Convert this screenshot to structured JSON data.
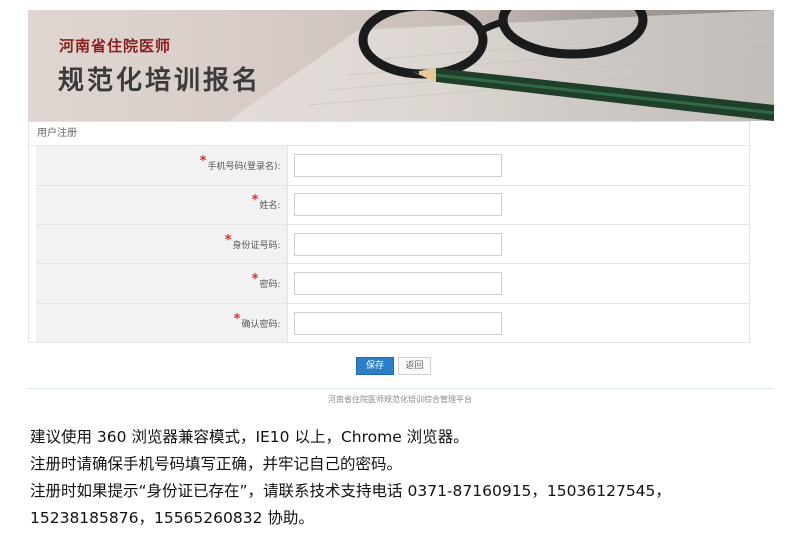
{
  "banner": {
    "subtitle": "河南省住院医师",
    "title": "规范化培训报名"
  },
  "form": {
    "section_title": "用户注册",
    "required_mark": "*",
    "fields": [
      {
        "label": "手机号码(登录名):",
        "value": "",
        "placeholder": ""
      },
      {
        "label": "姓名:",
        "value": "",
        "placeholder": ""
      },
      {
        "label": "身份证号码:",
        "value": "",
        "placeholder": ""
      },
      {
        "label": "密码:",
        "value": "",
        "placeholder": ""
      },
      {
        "label": "确认密码:",
        "value": "",
        "placeholder": ""
      }
    ]
  },
  "buttons": {
    "save": "保存",
    "back": "返回"
  },
  "footer": {
    "text": "河南省住院医师规范化培训综合管理平台"
  },
  "notes": [
    "建议使用 360 浏览器兼容模式，IE10 以上，Chrome 浏览器。",
    "注册时请确保手机号码填写正确，并牢记自己的密码。",
    "注册时如果提示“身份证已存在”，请联系技术支持电话 0371-87160915，15036127545，",
    "15238185876，15565260832 协助。"
  ]
}
